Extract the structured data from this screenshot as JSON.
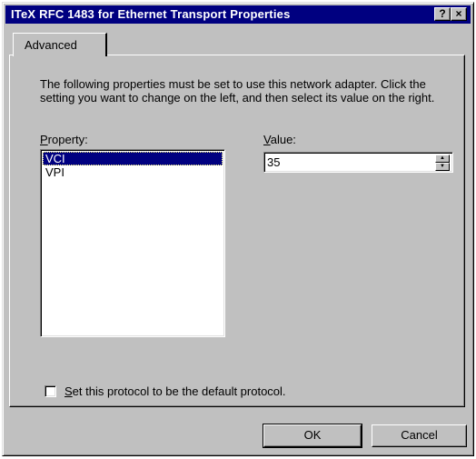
{
  "window": {
    "title": "ITeX RFC 1483 for Ethernet Transport Properties",
    "help_label": "?",
    "close_label": "×"
  },
  "tabs": [
    {
      "label": "Advanced",
      "active": true
    }
  ],
  "description": "The following properties must be set to use this network adapter. Click the setting you want to change on the left, and then select its value on the right.",
  "property": {
    "label_mnemonic": "P",
    "label_rest": "roperty:",
    "items": [
      {
        "label": "VCI",
        "selected": true
      },
      {
        "label": "VPI",
        "selected": false
      }
    ]
  },
  "value": {
    "label_mnemonic": "V",
    "label_rest": "alue:",
    "current": "35",
    "up_icon": "▲",
    "down_icon": "▼"
  },
  "default_protocol": {
    "label_mnemonic": "S",
    "label_rest": "et this protocol to be the default protocol.",
    "checked": false
  },
  "buttons": {
    "ok": "OK",
    "cancel": "Cancel"
  },
  "colors": {
    "titlebar": "#000080",
    "face": "#c0c0c0",
    "selection": "#000080"
  }
}
